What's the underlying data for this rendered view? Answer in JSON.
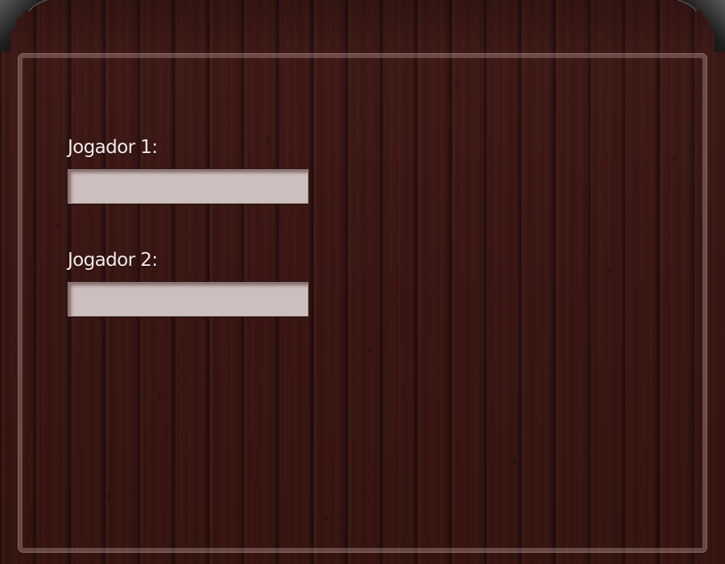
{
  "form": {
    "player1": {
      "label": "Jogador 1:",
      "value": "",
      "placeholder": ""
    },
    "player2": {
      "label": "Jogador 2:",
      "value": "",
      "placeholder": ""
    }
  },
  "colors": {
    "wood_background": "#3b1714",
    "input_fill": "#cdbfbe",
    "label_text": "#f4ecea",
    "frame_line": "#c8aaa5"
  },
  "icons": {
    "top_left_corner": "corner-ornament-icon",
    "top_right_corner": "corner-ornament-icon"
  }
}
